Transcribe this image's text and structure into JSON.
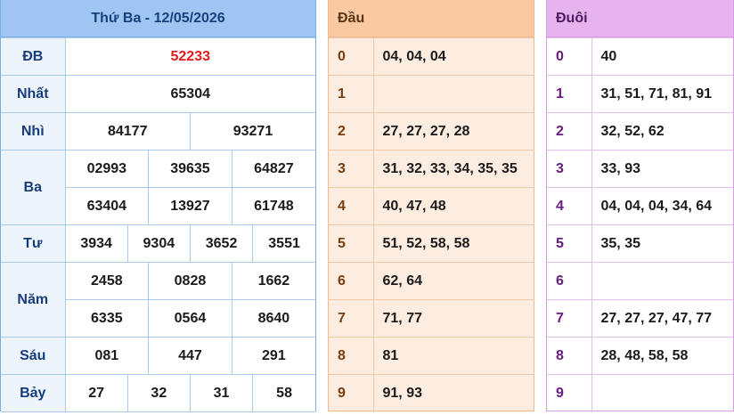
{
  "results": {
    "header": "Thứ Ba - 12/05/2026",
    "rows": [
      {
        "label": "ĐB",
        "values": [
          "52233"
        ]
      },
      {
        "label": "Nhất",
        "values": [
          "65304"
        ]
      },
      {
        "label": "Nhì",
        "values": [
          "84177",
          "93271"
        ]
      },
      {
        "label": "Ba",
        "values": [
          "02993",
          "39635",
          "64827",
          "63404",
          "13927",
          "61748"
        ]
      },
      {
        "label": "Tư",
        "values": [
          "3934",
          "9304",
          "3652",
          "3551"
        ]
      },
      {
        "label": "Năm",
        "values": [
          "2458",
          "0828",
          "1662",
          "6335",
          "0564",
          "8640"
        ]
      },
      {
        "label": "Sáu",
        "values": [
          "081",
          "447",
          "291"
        ]
      },
      {
        "label": "Bảy",
        "values": [
          "27",
          "32",
          "31",
          "58"
        ]
      }
    ]
  },
  "dau": {
    "header": "Đầu",
    "rows": [
      {
        "k": "0",
        "v": "04, 04, 04"
      },
      {
        "k": "1",
        "v": ""
      },
      {
        "k": "2",
        "v": "27, 27, 27, 28"
      },
      {
        "k": "3",
        "v": "31, 32, 33, 34, 35, 35"
      },
      {
        "k": "4",
        "v": "40, 47, 48"
      },
      {
        "k": "5",
        "v": "51, 52, 58, 58"
      },
      {
        "k": "6",
        "v": "62, 64"
      },
      {
        "k": "7",
        "v": "71, 77"
      },
      {
        "k": "8",
        "v": "81"
      },
      {
        "k": "9",
        "v": "91, 93"
      }
    ]
  },
  "duoi": {
    "header": "Đuôi",
    "rows": [
      {
        "k": "0",
        "v": "40"
      },
      {
        "k": "1",
        "v": "31, 51, 71, 81, 91"
      },
      {
        "k": "2",
        "v": "32, 52, 62"
      },
      {
        "k": "3",
        "v": "33, 93"
      },
      {
        "k": "4",
        "v": "04, 04, 04, 34, 64"
      },
      {
        "k": "5",
        "v": "35, 35"
      },
      {
        "k": "6",
        "v": ""
      },
      {
        "k": "7",
        "v": "27, 27, 27, 47, 77"
      },
      {
        "k": "8",
        "v": "28, 48, 58, 58"
      },
      {
        "k": "9",
        "v": ""
      }
    ]
  }
}
